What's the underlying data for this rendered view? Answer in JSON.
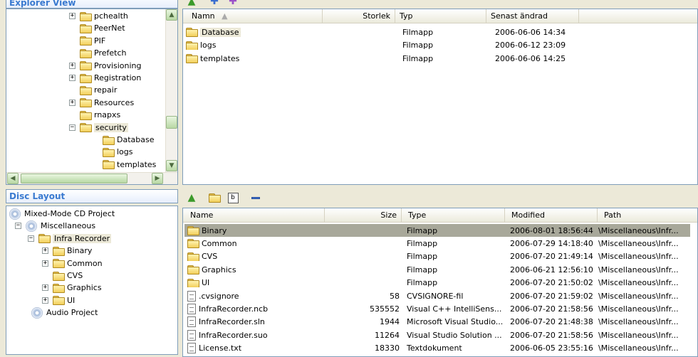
{
  "explorer": {
    "title": "Explorer View",
    "tree": [
      {
        "label": "pchealth",
        "expander": "+"
      },
      {
        "label": "PeerNet",
        "expander": ""
      },
      {
        "label": "PIF",
        "expander": ""
      },
      {
        "label": "Prefetch",
        "expander": ""
      },
      {
        "label": "Provisioning",
        "expander": "+"
      },
      {
        "label": "Registration",
        "expander": "+"
      },
      {
        "label": "repair",
        "expander": ""
      },
      {
        "label": "Resources",
        "expander": "+"
      },
      {
        "label": "rnapxs",
        "expander": ""
      },
      {
        "label": "security",
        "expander": "−"
      },
      {
        "label": "Database",
        "expander": ""
      },
      {
        "label": "logs",
        "expander": ""
      },
      {
        "label": "templates",
        "expander": ""
      }
    ],
    "columns": {
      "name": "Namn",
      "size": "Storlek",
      "type": "Typ",
      "modified": "Senast ändrad"
    },
    "files": [
      {
        "name": "Database",
        "size": "",
        "type": "Filmapp",
        "modified": "2006-06-06 14:34"
      },
      {
        "name": "logs",
        "size": "",
        "type": "Filmapp",
        "modified": "2006-06-12 23:09"
      },
      {
        "name": "templates",
        "size": "",
        "type": "Filmapp",
        "modified": "2006-06-06 14:25"
      }
    ]
  },
  "disc": {
    "title": "Disc Layout",
    "tree": [
      {
        "label": "Mixed-Mode CD Project"
      },
      {
        "label": "Miscellaneous"
      },
      {
        "label": "Infra Recorder"
      },
      {
        "label": "Binary",
        "expander": "+"
      },
      {
        "label": "Common",
        "expander": "+"
      },
      {
        "label": "CVS",
        "expander": ""
      },
      {
        "label": "Graphics",
        "expander": "+"
      },
      {
        "label": "UI",
        "expander": "+"
      },
      {
        "label": "Audio Project"
      }
    ],
    "columns": {
      "name": "Name",
      "size": "Size",
      "type": "Type",
      "modified": "Modified",
      "path": "Path"
    },
    "files": [
      {
        "name": "Binary",
        "size": "",
        "type": "Filmapp",
        "modified": "2006-08-01 18:56:44",
        "path": "\\Miscellaneous\\Infr...",
        "icon": "folder"
      },
      {
        "name": "Common",
        "size": "",
        "type": "Filmapp",
        "modified": "2006-07-29 14:18:40",
        "path": "\\Miscellaneous\\Infr...",
        "icon": "folder"
      },
      {
        "name": "CVS",
        "size": "",
        "type": "Filmapp",
        "modified": "2006-07-20 21:49:14",
        "path": "\\Miscellaneous\\Infr...",
        "icon": "folder"
      },
      {
        "name": "Graphics",
        "size": "",
        "type": "Filmapp",
        "modified": "2006-06-21 12:56:10",
        "path": "\\Miscellaneous\\Infr...",
        "icon": "folder"
      },
      {
        "name": "UI",
        "size": "",
        "type": "Filmapp",
        "modified": "2006-07-20 21:50:02",
        "path": "\\Miscellaneous\\Infr...",
        "icon": "folder"
      },
      {
        "name": ".cvsignore",
        "size": "58",
        "type": "CVSIGNORE-fil",
        "modified": "2006-07-20 21:59:02",
        "path": "\\Miscellaneous\\Infr...",
        "icon": "doc"
      },
      {
        "name": "InfraRecorder.ncb",
        "size": "535552",
        "type": "Visual C++ IntelliSens...",
        "modified": "2006-07-20 21:58:56",
        "path": "\\Miscellaneous\\Infr...",
        "icon": "doc"
      },
      {
        "name": "InfraRecorder.sln",
        "size": "1944",
        "type": "Microsoft Visual Studio...",
        "modified": "2006-07-20 21:48:38",
        "path": "\\Miscellaneous\\Infr...",
        "icon": "doc"
      },
      {
        "name": "InfraRecorder.suo",
        "size": "11264",
        "type": "Visual Studio Solution ...",
        "modified": "2006-07-20 21:58:56",
        "path": "\\Miscellaneous\\Infr...",
        "icon": "doc"
      },
      {
        "name": "License.txt",
        "size": "18330",
        "type": "Textdokument",
        "modified": "2006-06-05 23:55:16",
        "path": "\\Miscellaneous\\Infr...",
        "icon": "doc"
      }
    ]
  },
  "colors": {
    "accent": "#3a7ad0",
    "selection": "#a8a89a",
    "border": "#7f9db9"
  }
}
